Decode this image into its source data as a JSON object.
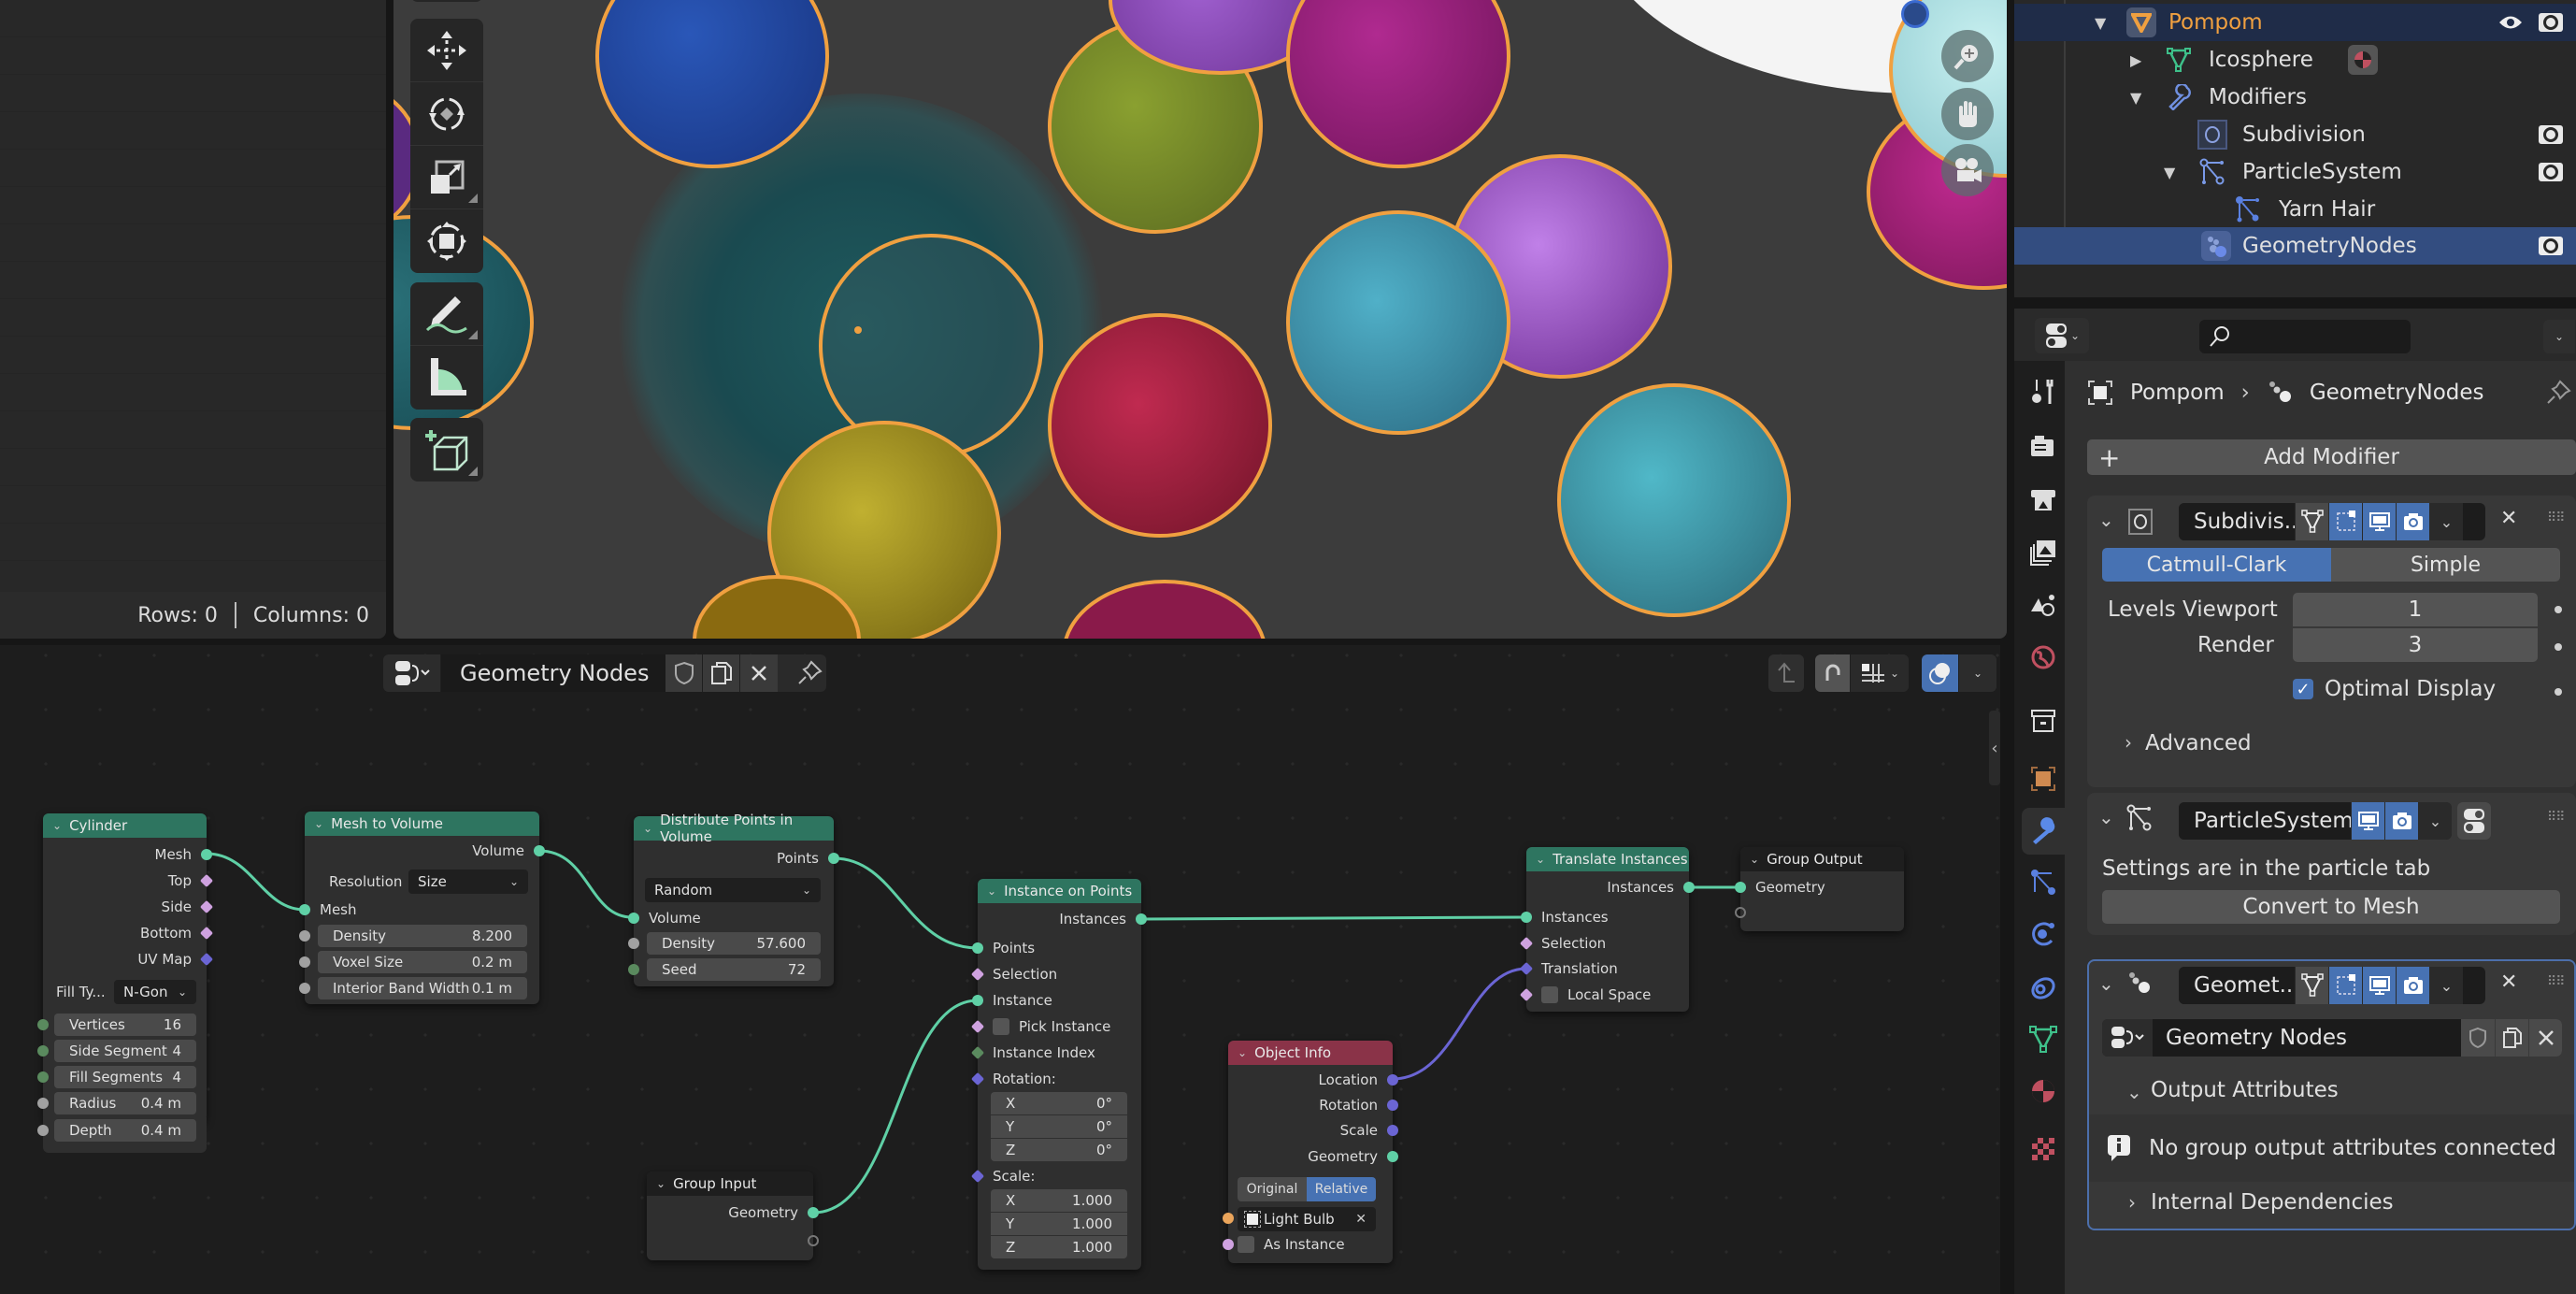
{
  "spreadsheet": {
    "rows_label": "Rows: 0",
    "columns_label": "Columns: 0"
  },
  "viewport": {
    "tools": [
      {
        "name": "move",
        "icon": "move-icon"
      },
      {
        "name": "rotate",
        "icon": "rotate-icon"
      },
      {
        "name": "scale",
        "icon": "scale-icon"
      },
      {
        "name": "transform",
        "icon": "transform-icon"
      },
      {
        "name": "annotate",
        "icon": "annotate-icon"
      },
      {
        "name": "measure",
        "icon": "measure-icon"
      },
      {
        "name": "add-cube",
        "icon": "add-cube-icon"
      }
    ],
    "nav": [
      "zoom-icon",
      "pan-hand-icon",
      "camera-view-icon"
    ],
    "pompom_colors": [
      "#1e3f8a",
      "#6a2a90",
      "#7a8a2a",
      "#8a2a8a",
      "#2a6a70",
      "#9a4ac0",
      "#8a1a3a",
      "#2a7a8a",
      "#8a8a2a",
      "#2aa0a8",
      "#9a1a6a",
      "#b0d8d8",
      "#7a6a1a",
      "#8a1a4a"
    ]
  },
  "node_editor": {
    "header": {
      "tree_name": "Geometry Nodes",
      "overlay_color": "#4772b3"
    },
    "nodes": {
      "cylinder": {
        "title": "Cylinder",
        "outputs": [
          "Mesh",
          "Top",
          "Side",
          "Bottom",
          "UV Map"
        ],
        "fill_type_label": "Fill Ty...",
        "fill_type_value": "N-Gon",
        "fields": [
          {
            "label": "Vertices",
            "value": "16"
          },
          {
            "label": "Side Segment",
            "value": "4"
          },
          {
            "label": "Fill Segments",
            "value": "4"
          },
          {
            "label": "Radius",
            "value": "0.4 m"
          },
          {
            "label": "Depth",
            "value": "0.4 m"
          }
        ]
      },
      "mesh_to_volume": {
        "title": "Mesh to Volume",
        "output": "Volume",
        "resolution_label": "Resolution",
        "resolution_value": "Size",
        "input": "Mesh",
        "fields": [
          {
            "label": "Density",
            "value": "8.200"
          },
          {
            "label": "Voxel Size",
            "value": "0.2 m"
          },
          {
            "label": "Interior Band Width",
            "value": "0.1 m"
          }
        ]
      },
      "distribute": {
        "title": "Distribute Points in Volume",
        "output": "Points",
        "mode": "Random",
        "input": "Volume",
        "fields": [
          {
            "label": "Density",
            "value": "57.600"
          },
          {
            "label": "Seed",
            "value": "72"
          }
        ]
      },
      "instance_on_points": {
        "title": "Instance on Points",
        "output": "Instances",
        "inputs": [
          "Points",
          "Selection",
          "Instance",
          "Pick Instance",
          "Instance Index",
          "Rotation:"
        ],
        "rotation": [
          {
            "axis": "X",
            "value": "0°"
          },
          {
            "axis": "Y",
            "value": "0°"
          },
          {
            "axis": "Z",
            "value": "0°"
          }
        ],
        "scale_label": "Scale:",
        "scale": [
          {
            "axis": "X",
            "value": "1.000"
          },
          {
            "axis": "Y",
            "value": "1.000"
          },
          {
            "axis": "Z",
            "value": "1.000"
          }
        ]
      },
      "group_input": {
        "title": "Group Input",
        "output": "Geometry"
      },
      "object_info": {
        "title": "Object Info",
        "outputs": [
          "Location",
          "Rotation",
          "Scale",
          "Geometry"
        ],
        "mode_options": [
          "Original",
          "Relative"
        ],
        "mode_selected": "Relative",
        "object": "Light Bulb",
        "as_instance": "As Instance"
      },
      "translate_instances": {
        "title": "Translate Instances",
        "output": "Instances",
        "inputs": [
          "Instances",
          "Selection",
          "Translation",
          "Local Space"
        ]
      },
      "group_output": {
        "title": "Group Output",
        "input": "Geometry"
      }
    }
  },
  "outliner": {
    "items": [
      {
        "label": "Pompom",
        "type": "object",
        "expanded": true
      },
      {
        "label": "Icosphere",
        "type": "mesh-data",
        "expanded": false
      },
      {
        "label": "Modifiers",
        "type": "modifiers",
        "expanded": true
      },
      {
        "label": "Subdivision",
        "type": "modifier"
      },
      {
        "label": "ParticleSystem",
        "type": "modifier",
        "expanded": true
      },
      {
        "label": "Yarn Hair",
        "type": "particle-settings"
      },
      {
        "label": "GeometryNodes",
        "type": "modifier",
        "selected": true
      }
    ]
  },
  "properties": {
    "search_placeholder": "",
    "breadcrumb": {
      "object": "Pompom",
      "modifier": "GeometryNodes"
    },
    "add_modifier": "Add Modifier",
    "subdivision": {
      "name": "Subdivis...",
      "algorithms": [
        "Catmull-Clark",
        "Simple"
      ],
      "algorithm_selected": "Catmull-Clark",
      "levels_viewport_label": "Levels Viewport",
      "levels_viewport": "1",
      "render_label": "Render",
      "render": "3",
      "optimal_display_label": "Optimal Display",
      "optimal_display": true,
      "advanced_label": "Advanced"
    },
    "particle_system": {
      "name": "ParticleSystem",
      "info": "Settings are in the particle tab",
      "convert_button": "Convert to Mesh"
    },
    "geometry_nodes": {
      "name": "Geomet...",
      "tree_name": "Geometry Nodes",
      "output_attributes_label": "Output Attributes",
      "info": "No group output attributes connected",
      "internal_deps_label": "Internal Dependencies"
    },
    "accent_color": "#4772b3"
  }
}
